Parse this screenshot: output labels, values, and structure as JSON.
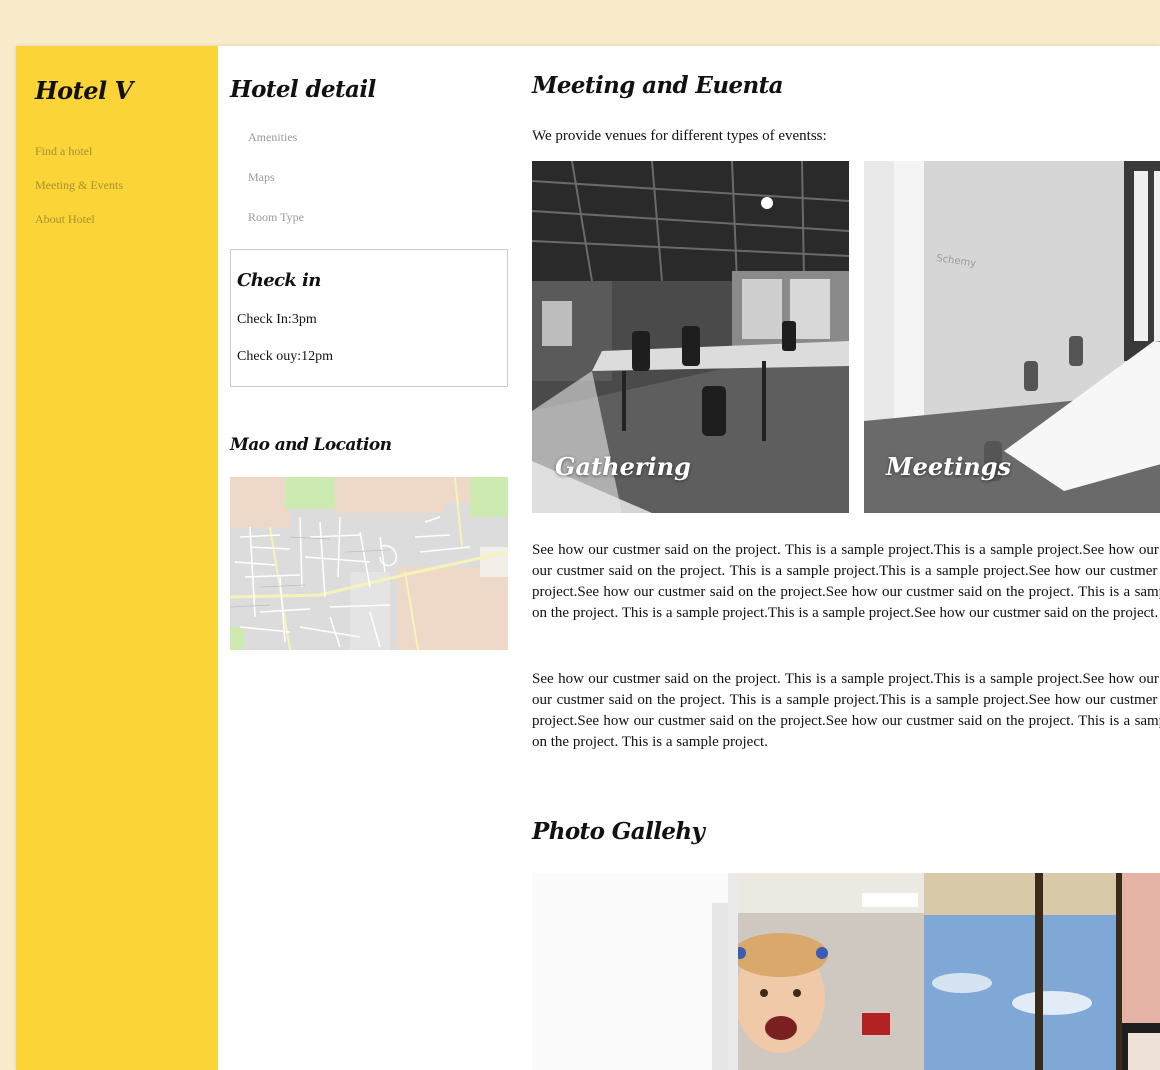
{
  "brand": "Hotel V",
  "sidebar": {
    "items": [
      {
        "label": "Find a hotel"
      },
      {
        "label": "Meeting & Events"
      },
      {
        "label": "About Hotel"
      }
    ]
  },
  "hotel_detail": {
    "title": "Hotel detail",
    "links": [
      {
        "label": "Amenities"
      },
      {
        "label": "Maps"
      },
      {
        "label": "Room Type"
      }
    ]
  },
  "checkin": {
    "title": "Check in",
    "check_in": "Check In:3pm",
    "check_out": "Check ouy:12pm"
  },
  "map_section": {
    "title": "Mao and Location"
  },
  "meetings": {
    "title": "Meeting and Euenta",
    "intro": "We provide venues for different types of eventss:",
    "cards": [
      {
        "label": "Gathering"
      },
      {
        "label": "Meetings"
      }
    ],
    "paragraph1": "See how our custmer said on the project. This is a sample project.This is a sample project.See how our custmer said on the project.This is a sample project.See how our custmer said on the project. This is a sample project.This is a sample project.See how our custmer said on the project. This is a sample project.This is a sample project.See how our custmer said on the project.See how our custmer said on the project. This is a sample project.This is a sample project.See how our custmer said on the project. This is a sample project.This is a sample project.See how our custmer said on the project. This is a sample project.",
    "paragraph2": "See how our custmer said on the project. This is a sample project.This is a sample project.See how our custmer said on the project.This is a sample project.See how our custmer said on the project. This is a sample project.This is a sample project.See how our custmer said on the project. This is a sample project.This is a sample project.See how our custmer said on the project.See how our custmer said on the project. This is a sample project.This is a sample project.See how our custmer said on the project. This is a sample project."
  },
  "gallery": {
    "title": "Photo Gallehy"
  },
  "colors": {
    "sidebar": "#fbd437",
    "background": "#f8ecca",
    "nav_text": "#a8902e"
  }
}
